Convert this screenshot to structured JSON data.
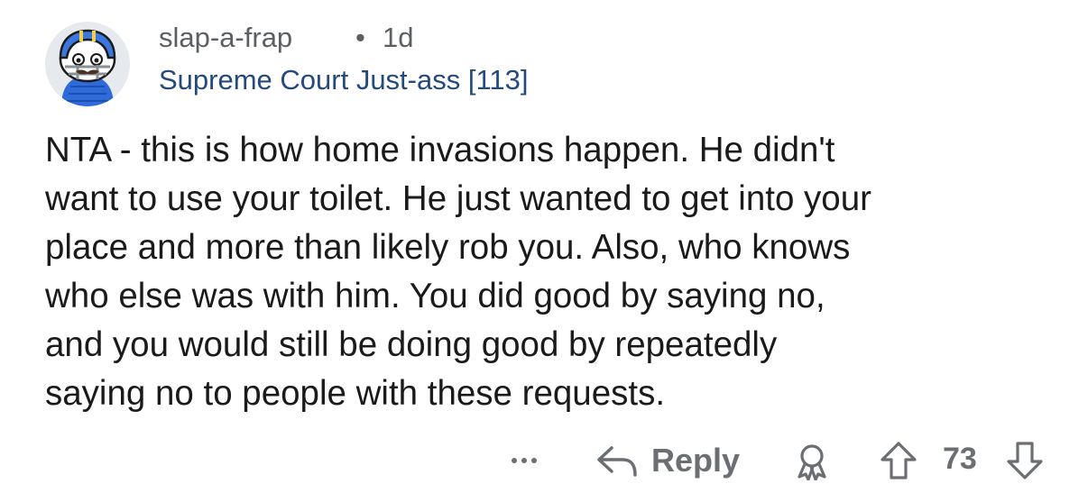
{
  "comment": {
    "author": "slap-a-frap",
    "separator": "•",
    "age": "1d",
    "flair": "Supreme Court Just-ass [113]",
    "body_lines": [
      "NTA - this is how home invasions happen.  He didn't",
      "want to use your toilet.  He just wanted to get into your",
      "place and more than likely rob you.  Also, who knows",
      "who else was with him.  You did good by saying no,",
      "and you would still be doing good by repeatedly",
      "saying no to people with these requests."
    ]
  },
  "actions": {
    "reply_label": "Reply",
    "vote_count": "73",
    "more_icon": "more-options-icon",
    "reply_icon": "reply-arrow-icon",
    "award_icon": "award-icon",
    "upvote_icon": "upvote-arrow-icon",
    "downvote_icon": "downvote-arrow-icon"
  },
  "colors": {
    "text": "#1a1a1b",
    "meta": "#5b5e62",
    "flair": "#24497f",
    "action": "#6b6e72",
    "avatar_bg": "#e6eaee"
  }
}
